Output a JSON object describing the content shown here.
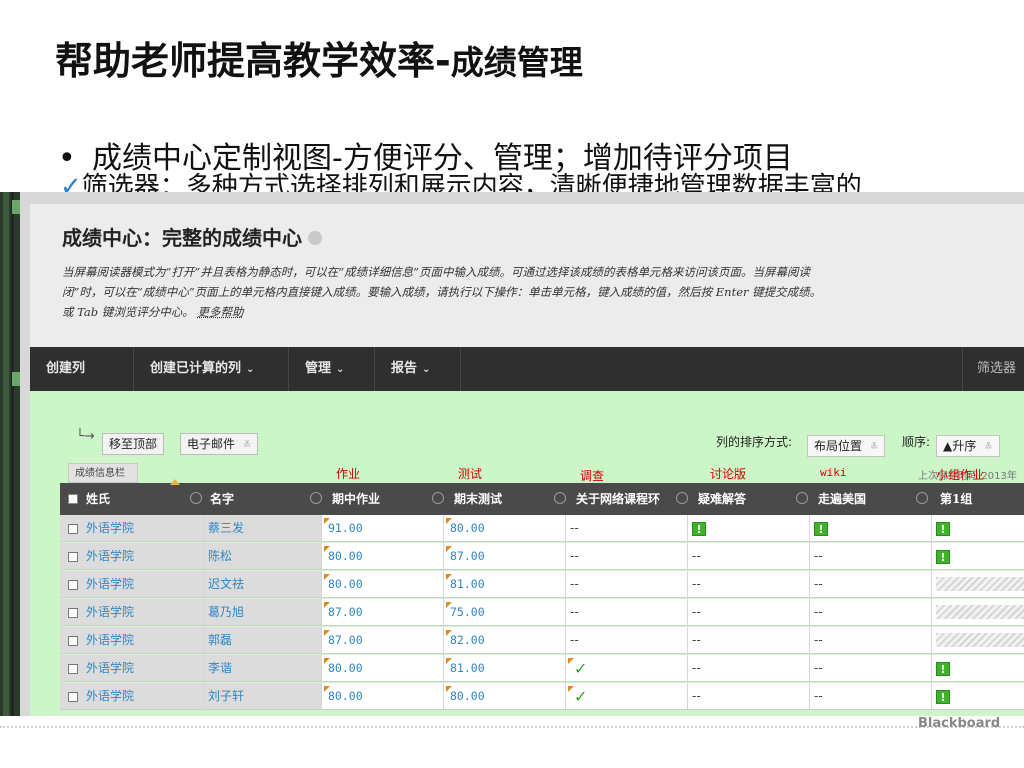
{
  "slide": {
    "title_main": "帮助老师提高教学效率-",
    "title_suffix": "成绩管理",
    "bullet": "成绩中心定制视图-方便评分、管理；增加待评分项目",
    "sub_bullet_check": "✓",
    "sub_bullet": "筛选器：多种方式选择排列和展示内容，清晰便捷地管理数据丰富的"
  },
  "gradecenter": {
    "title": "成绩中心：完整的成绩中心",
    "desc_line1": "当屏幕阅读器模式为“打开”并且表格为静态时，可以在“成绩详细信息”页面中输入成绩。可通过选择该成绩的表格单元格来访问该页面。当屏幕阅读",
    "desc_line2": "闭”时，可以在“成绩中心”页面上的单元格内直接键入成绩。要输入成绩，请执行以下操作：单击单元格，键入成绩的值，然后按 Enter 键提交成绩。",
    "desc_line3": "或 Tab 键浏览评分中心。",
    "more_help": "更多帮助"
  },
  "toolbar": {
    "create_column": "创建列",
    "create_calc": "创建已计算的列",
    "manage": "管理",
    "reports": "报告",
    "filter": "筛选器"
  },
  "actions": {
    "move_top": "移至顶部",
    "email": "电子邮件",
    "sort_label": "列的排序方式:",
    "sort_value": "布局位置",
    "order_label": "顺序:",
    "order_value": "▲升序"
  },
  "categories": {
    "info_bar": "成绩信息栏",
    "homework": "作业",
    "test": "测试",
    "survey": "调查",
    "forum": "讨论版",
    "wiki": "wiki",
    "group": "小组作业",
    "last_saved": "上次保存时间:2013年"
  },
  "table": {
    "headers": [
      "姓氏",
      "名字",
      "期中作业",
      "期末测试",
      "关于网络课程环",
      "疑难解答",
      "走遍美国",
      "第1组"
    ],
    "rows": [
      {
        "last": "外语学院",
        "first": "蔡三发",
        "mid": "91.00",
        "final": "80.00",
        "survey": "--",
        "qa": "!",
        "usa": "!",
        "g1": "!"
      },
      {
        "last": "外语学院",
        "first": "陈松",
        "mid": "80.00",
        "final": "87.00",
        "survey": "--",
        "qa": "--",
        "usa": "--",
        "g1": "!"
      },
      {
        "last": "外语学院",
        "first": "迟文祛",
        "mid": "80.00",
        "final": "81.00",
        "survey": "--",
        "qa": "--",
        "usa": "--",
        "g1": "hatch"
      },
      {
        "last": "外语学院",
        "first": "葛乃旭",
        "mid": "87.00",
        "final": "75.00",
        "survey": "--",
        "qa": "--",
        "usa": "--",
        "g1": "hatch"
      },
      {
        "last": "外语学院",
        "first": "郭磊",
        "mid": "87.00",
        "final": "82.00",
        "survey": "--",
        "qa": "--",
        "usa": "--",
        "g1": "hatch"
      },
      {
        "last": "外语学院",
        "first": "李谐",
        "mid": "80.00",
        "final": "81.00",
        "survey": "✓",
        "qa": "--",
        "usa": "--",
        "g1": "!"
      },
      {
        "last": "外语学院",
        "first": "刘子轩",
        "mid": "80.00",
        "final": "80.00",
        "survey": "✓",
        "qa": "--",
        "usa": "--",
        "g1": "!"
      }
    ]
  },
  "footer": {
    "brand": "Blackboard"
  }
}
